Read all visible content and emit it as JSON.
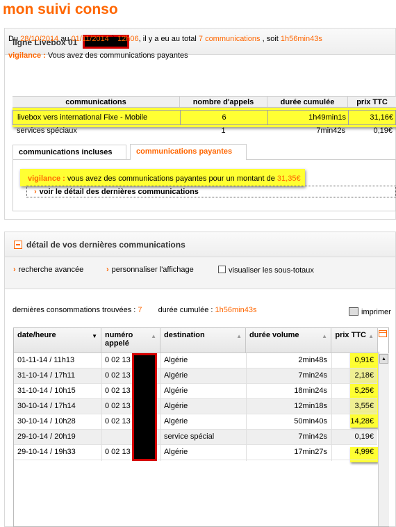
{
  "page": {
    "title": "mon suivi conso"
  },
  "line": {
    "label": "ligne Livebox 01"
  },
  "summary": {
    "prefix": "Du",
    "from": "28/10/2014",
    "to_word": "au",
    "to": "01/11/2014",
    "at_word": "à",
    "time": "12h06",
    "mid": ", il y a eu au total",
    "count": "7 communications",
    "sep": ", soit",
    "duration": "1h56min43s"
  },
  "vigilance1": {
    "label": "vigilance :",
    "text": " Vous avez des communications payantes"
  },
  "conso_table": {
    "headers": [
      "communications",
      "nombre d'appels",
      "durée cumulée",
      "prix TTC"
    ],
    "rows": [
      {
        "name": "livebox vers international Fixe - Mobile",
        "calls": "6",
        "duration": "1h49min1s",
        "price": "31,16€"
      },
      {
        "name": "services spéciaux",
        "calls": "1",
        "duration": "7min42s",
        "price": "0,19€"
      }
    ]
  },
  "tabs": {
    "included": "communications incluses",
    "paid": "communications payantes"
  },
  "vigilance2": {
    "label": "vigilance :",
    "text": " vous avez des communications payantes pour un montant de ",
    "amount": "31,35€"
  },
  "detail_link": "voir le détail des dernières communications",
  "detail": {
    "title": "détail de vos dernières communications",
    "advanced_search": "recherche avancée",
    "customize": "personnaliser l'affichage",
    "subtotals": "visualiser les sous-totaux",
    "found_label": "dernières consommations trouvées :",
    "found_count": "7",
    "cum_label": "durée cumulée :",
    "cum_value": "1h56min43s",
    "print": "imprimer",
    "headers": {
      "date": "date/heure",
      "number": "numéro appelé",
      "destination": "destination",
      "volume": "durée volume",
      "price": "prix TTC"
    },
    "rows": [
      {
        "date": "01-11-14 / 11h13",
        "number": "0 02 13 4",
        "destination": "Algérie",
        "volume": "2min48s",
        "price": "0,91€"
      },
      {
        "date": "31-10-14 / 17h11",
        "number": "0 02 13 4",
        "destination": "Algérie",
        "volume": "7min24s",
        "price": "2,18€"
      },
      {
        "date": "31-10-14 / 10h15",
        "number": "0 02 13 4",
        "destination": "Algérie",
        "volume": "18min24s",
        "price": "5,25€"
      },
      {
        "date": "30-10-14 / 17h14",
        "number": "0 02 13 4",
        "destination": "Algérie",
        "volume": "12min18s",
        "price": "3,55€"
      },
      {
        "date": "30-10-14 / 10h28",
        "number": "0 02 13 4",
        "destination": "Algérie",
        "volume": "50min40s",
        "price": "14,28€"
      },
      {
        "date": "29-10-14 / 20h19",
        "number": "",
        "destination": "service spécial",
        "volume": "7min42s",
        "price": "0,19€"
      },
      {
        "date": "29-10-14 / 19h33",
        "number": "0 02 13 4",
        "destination": "Algérie",
        "volume": "17min27s",
        "price": "4,99€"
      }
    ]
  },
  "colors": {
    "accent": "#ff6600",
    "highlight": "#ffff33",
    "redaction_border": "#d40000"
  }
}
